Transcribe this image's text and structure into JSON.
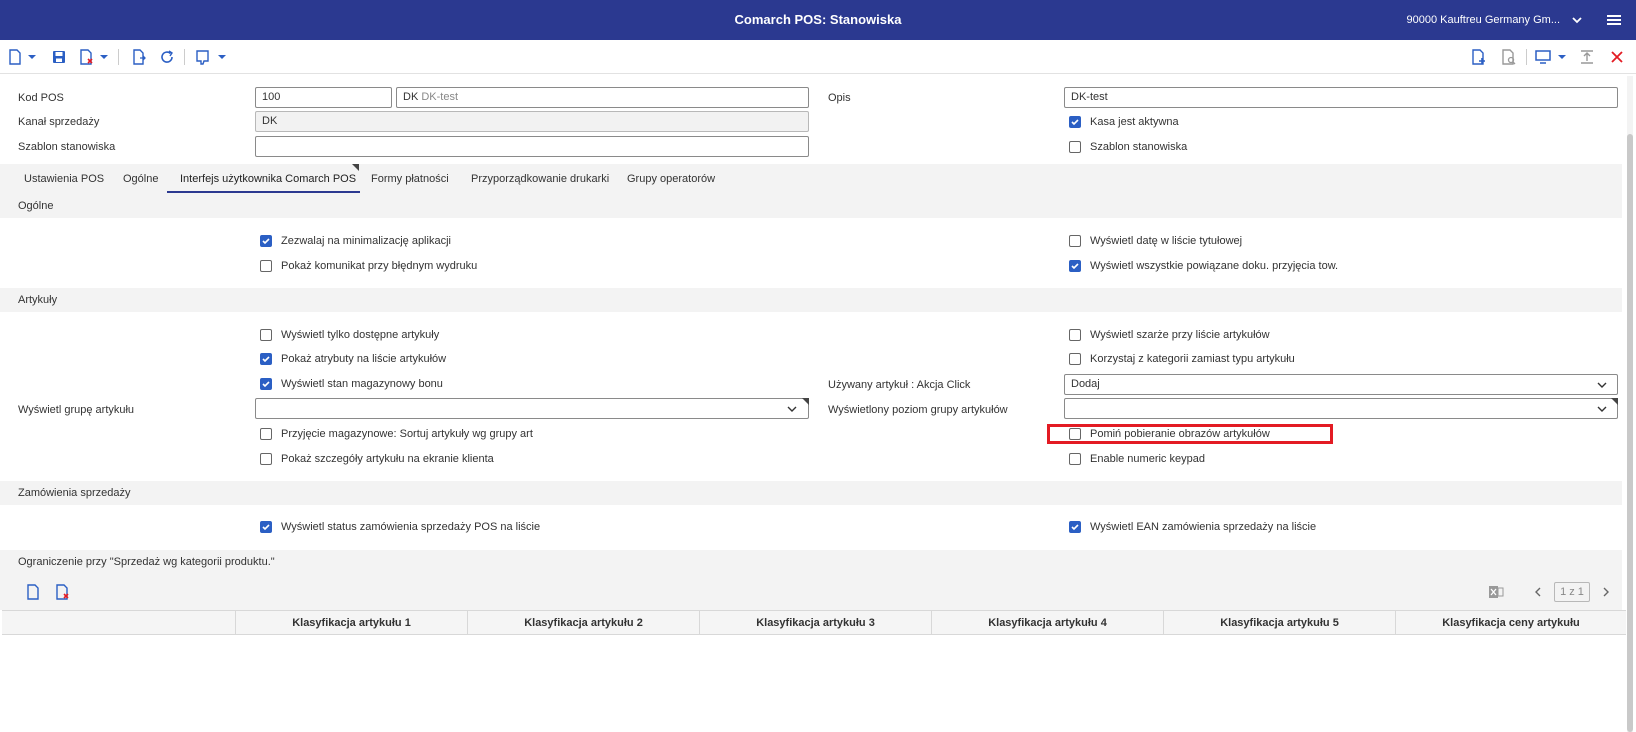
{
  "titlebar": {
    "title": "Comarch POS: Stanowiska",
    "company": "90000  Kauftreu Germany Gm..."
  },
  "header": {
    "kod_pos_label": "Kod POS",
    "kod_pos_value": "100",
    "name_prefix": "DK",
    "name_value": "DK-test",
    "opis_label": "Opis",
    "opis_value": "DK-test",
    "kanal_label": "Kanał sprzedaży",
    "kanal_value": "DK",
    "szablon_label": "Szablon stanowiska",
    "szablon_value": "",
    "kasa_aktywna_label": "Kasa jest aktywna",
    "szablon_cb_label": "Szablon stanowiska"
  },
  "tabs": [
    "Ustawienia POS",
    "Ogólne",
    "Interfejs użytkownika Comarch POS",
    "Formy płatności",
    "Przyporządkowanie drukarki",
    "Grupy operatorów"
  ],
  "sections": {
    "ogolne": "Ogólne",
    "artykuly": "Artykuły",
    "zamowienia": "Zamówienia sprzedaży",
    "ograniczenie": "Ograniczenie przy \"Sprzedaż wg kategorii produktu.\""
  },
  "ogolne": {
    "minimalizacja": "Zezwalaj na minimalizację aplikacji",
    "komunikat": "Pokaż komunikat przy błędnym wydruku",
    "data_tytul": "Wyświetl datę w liście tytułowej",
    "dokumenty": "Wyświetl wszystkie powiązane doku. przyjęcia tow."
  },
  "artykuly": {
    "tylko_dostepne": "Wyświetl tylko dostępne artykuły",
    "atrybuty": "Pokaż atrybuty na liście artykułów",
    "stan_bonu": "Wyświetl stan magazynowy bonu",
    "grupa_label": "Wyświetl grupę artykułu",
    "grupa_value": "",
    "sortuj": "Przyjęcie magazynowe: Sortuj artykuły wg grupy art",
    "szczegoly": "Pokaż szczegóły artykułu na ekranie klienta",
    "akcja_label": "Używany artykuł : Akcja Click",
    "akcja_value": "Dodaj",
    "poziom_label": "Wyświetlony poziom grupy artykułów",
    "poziom_value": "",
    "szarze": "Wyświetl szarże przy liście artykułów",
    "kategorie": "Korzystaj z kategorii zamiast typu artykułu",
    "pomin_obrazy": "Pomiń pobieranie obrazów artykułów",
    "numeric_keypad": "Enable numeric keypad"
  },
  "zamowienia": {
    "status": "Wyświetl status zamówienia sprzedaży POS na liście",
    "ean": "Wyświetl EAN zamówienia sprzedaży na liście"
  },
  "grid": {
    "columns": [
      "Klasyfikacja artykułu 1",
      "Klasyfikacja artykułu 2",
      "Klasyfikacja artykułu 3",
      "Klasyfikacja artykułu 4",
      "Klasyfikacja artykułu 5",
      "Klasyfikacja ceny artykułu"
    ],
    "pager": "1 z 1"
  },
  "colors": {
    "titlebar": "#2b3990",
    "accent": "#2b5fc4",
    "highlight": "#e31b23"
  }
}
